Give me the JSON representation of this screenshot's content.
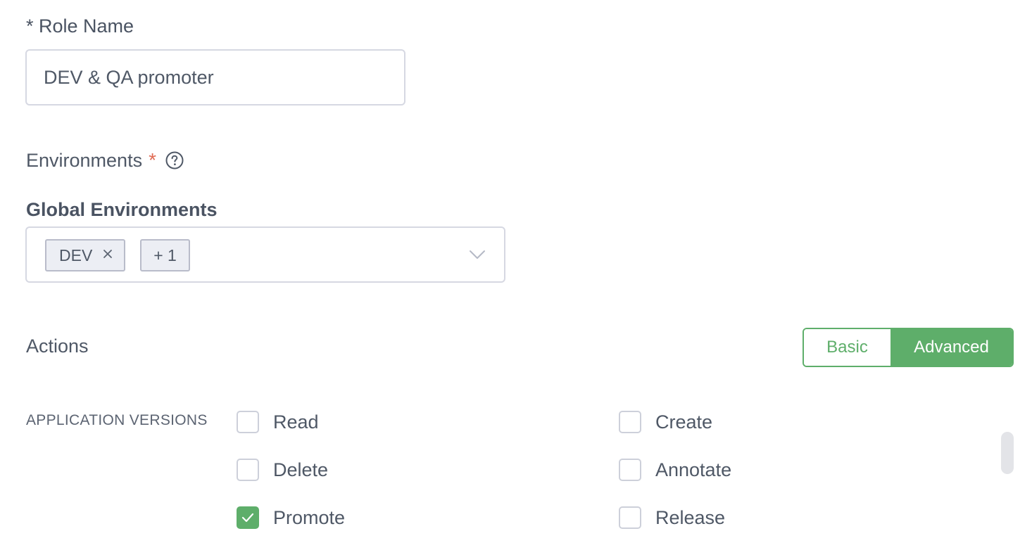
{
  "role_name": {
    "label": "* Role Name",
    "value": "DEV & QA promoter"
  },
  "environments": {
    "label": "Environments",
    "required_marker": "*",
    "help_icon": "question-circle-icon"
  },
  "global_environments": {
    "label": "Global Environments",
    "tags": [
      "DEV"
    ],
    "more_tag": "+ 1",
    "dropdown_icon": "chevron-down-icon"
  },
  "actions": {
    "label": "Actions",
    "modes": {
      "basic": "Basic",
      "advanced": "Advanced",
      "selected": "Advanced"
    }
  },
  "application_versions": {
    "label": "APPLICATION VERSIONS",
    "permissions": [
      {
        "label": "Read",
        "checked": false
      },
      {
        "label": "Create",
        "checked": false
      },
      {
        "label": "Delete",
        "checked": false
      },
      {
        "label": "Annotate",
        "checked": false
      },
      {
        "label": "Promote",
        "checked": true
      },
      {
        "label": "Release",
        "checked": false
      }
    ]
  },
  "colors": {
    "accent_green": "#5eae6a",
    "required_red": "#e06b54",
    "text": "#4f5866",
    "border": "#d6d8e2"
  }
}
